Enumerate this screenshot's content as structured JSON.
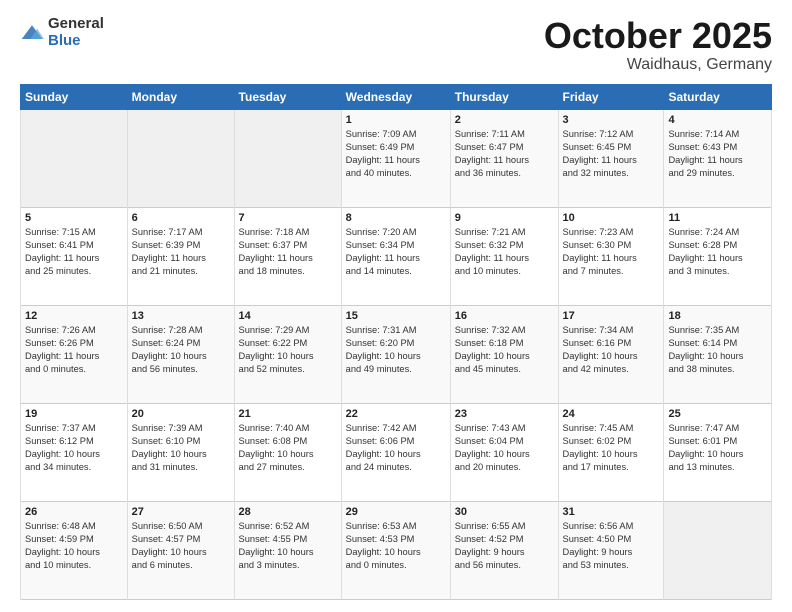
{
  "header": {
    "logo_line1": "General",
    "logo_line2": "Blue",
    "calendar_title": "October 2025",
    "calendar_subtitle": "Waidhaus, Germany"
  },
  "days_of_week": [
    "Sunday",
    "Monday",
    "Tuesday",
    "Wednesday",
    "Thursday",
    "Friday",
    "Saturday"
  ],
  "weeks": [
    [
      {
        "day": "",
        "info": ""
      },
      {
        "day": "",
        "info": ""
      },
      {
        "day": "",
        "info": ""
      },
      {
        "day": "1",
        "info": "Sunrise: 7:09 AM\nSunset: 6:49 PM\nDaylight: 11 hours\nand 40 minutes."
      },
      {
        "day": "2",
        "info": "Sunrise: 7:11 AM\nSunset: 6:47 PM\nDaylight: 11 hours\nand 36 minutes."
      },
      {
        "day": "3",
        "info": "Sunrise: 7:12 AM\nSunset: 6:45 PM\nDaylight: 11 hours\nand 32 minutes."
      },
      {
        "day": "4",
        "info": "Sunrise: 7:14 AM\nSunset: 6:43 PM\nDaylight: 11 hours\nand 29 minutes."
      }
    ],
    [
      {
        "day": "5",
        "info": "Sunrise: 7:15 AM\nSunset: 6:41 PM\nDaylight: 11 hours\nand 25 minutes."
      },
      {
        "day": "6",
        "info": "Sunrise: 7:17 AM\nSunset: 6:39 PM\nDaylight: 11 hours\nand 21 minutes."
      },
      {
        "day": "7",
        "info": "Sunrise: 7:18 AM\nSunset: 6:37 PM\nDaylight: 11 hours\nand 18 minutes."
      },
      {
        "day": "8",
        "info": "Sunrise: 7:20 AM\nSunset: 6:34 PM\nDaylight: 11 hours\nand 14 minutes."
      },
      {
        "day": "9",
        "info": "Sunrise: 7:21 AM\nSunset: 6:32 PM\nDaylight: 11 hours\nand 10 minutes."
      },
      {
        "day": "10",
        "info": "Sunrise: 7:23 AM\nSunset: 6:30 PM\nDaylight: 11 hours\nand 7 minutes."
      },
      {
        "day": "11",
        "info": "Sunrise: 7:24 AM\nSunset: 6:28 PM\nDaylight: 11 hours\nand 3 minutes."
      }
    ],
    [
      {
        "day": "12",
        "info": "Sunrise: 7:26 AM\nSunset: 6:26 PM\nDaylight: 11 hours\nand 0 minutes."
      },
      {
        "day": "13",
        "info": "Sunrise: 7:28 AM\nSunset: 6:24 PM\nDaylight: 10 hours\nand 56 minutes."
      },
      {
        "day": "14",
        "info": "Sunrise: 7:29 AM\nSunset: 6:22 PM\nDaylight: 10 hours\nand 52 minutes."
      },
      {
        "day": "15",
        "info": "Sunrise: 7:31 AM\nSunset: 6:20 PM\nDaylight: 10 hours\nand 49 minutes."
      },
      {
        "day": "16",
        "info": "Sunrise: 7:32 AM\nSunset: 6:18 PM\nDaylight: 10 hours\nand 45 minutes."
      },
      {
        "day": "17",
        "info": "Sunrise: 7:34 AM\nSunset: 6:16 PM\nDaylight: 10 hours\nand 42 minutes."
      },
      {
        "day": "18",
        "info": "Sunrise: 7:35 AM\nSunset: 6:14 PM\nDaylight: 10 hours\nand 38 minutes."
      }
    ],
    [
      {
        "day": "19",
        "info": "Sunrise: 7:37 AM\nSunset: 6:12 PM\nDaylight: 10 hours\nand 34 minutes."
      },
      {
        "day": "20",
        "info": "Sunrise: 7:39 AM\nSunset: 6:10 PM\nDaylight: 10 hours\nand 31 minutes."
      },
      {
        "day": "21",
        "info": "Sunrise: 7:40 AM\nSunset: 6:08 PM\nDaylight: 10 hours\nand 27 minutes."
      },
      {
        "day": "22",
        "info": "Sunrise: 7:42 AM\nSunset: 6:06 PM\nDaylight: 10 hours\nand 24 minutes."
      },
      {
        "day": "23",
        "info": "Sunrise: 7:43 AM\nSunset: 6:04 PM\nDaylight: 10 hours\nand 20 minutes."
      },
      {
        "day": "24",
        "info": "Sunrise: 7:45 AM\nSunset: 6:02 PM\nDaylight: 10 hours\nand 17 minutes."
      },
      {
        "day": "25",
        "info": "Sunrise: 7:47 AM\nSunset: 6:01 PM\nDaylight: 10 hours\nand 13 minutes."
      }
    ],
    [
      {
        "day": "26",
        "info": "Sunrise: 6:48 AM\nSunset: 4:59 PM\nDaylight: 10 hours\nand 10 minutes."
      },
      {
        "day": "27",
        "info": "Sunrise: 6:50 AM\nSunset: 4:57 PM\nDaylight: 10 hours\nand 6 minutes."
      },
      {
        "day": "28",
        "info": "Sunrise: 6:52 AM\nSunset: 4:55 PM\nDaylight: 10 hours\nand 3 minutes."
      },
      {
        "day": "29",
        "info": "Sunrise: 6:53 AM\nSunset: 4:53 PM\nDaylight: 10 hours\nand 0 minutes."
      },
      {
        "day": "30",
        "info": "Sunrise: 6:55 AM\nSunset: 4:52 PM\nDaylight: 9 hours\nand 56 minutes."
      },
      {
        "day": "31",
        "info": "Sunrise: 6:56 AM\nSunset: 4:50 PM\nDaylight: 9 hours\nand 53 minutes."
      },
      {
        "day": "",
        "info": ""
      }
    ]
  ]
}
